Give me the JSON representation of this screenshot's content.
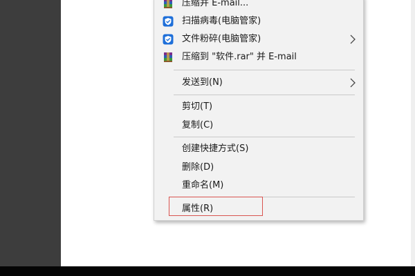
{
  "menu": {
    "items": [
      {
        "label": "压缩并 E-mail...",
        "icon": "winrar-icon"
      },
      {
        "label": "扫描病毒(电脑管家)",
        "icon": "shield-icon"
      },
      {
        "label": "文件粉碎(电脑管家)",
        "icon": "shield-icon",
        "has_submenu": true
      },
      {
        "label": "压缩到 \"软件.rar\" 并 E-mail",
        "icon": "winrar-icon"
      },
      {
        "label": "发送到(N)",
        "has_submenu": true
      },
      {
        "label": "剪切(T)"
      },
      {
        "label": "复制(C)"
      },
      {
        "label": "创建快捷方式(S)"
      },
      {
        "label": "删除(D)"
      },
      {
        "label": "重命名(M)"
      },
      {
        "label": "属性(R)",
        "highlighted": true
      }
    ]
  },
  "colors": {
    "menu_bg": "#f2f2f2",
    "highlight_border": "#d9534f",
    "shield": "#1e6fd9",
    "left_panel": "#3d3d3d"
  }
}
